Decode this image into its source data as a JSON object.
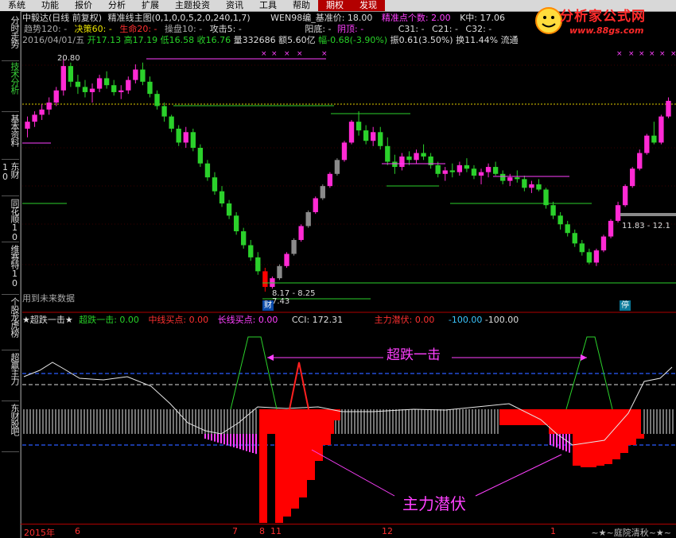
{
  "menubar": [
    "系统",
    "功能",
    "报价",
    "分析",
    "扩展",
    "主题投资",
    "资讯",
    "工具",
    "帮助",
    "期权",
    "发现"
  ],
  "menubar_highlight": [
    9,
    10
  ],
  "sidetabs": [
    "分时走势",
    "技术分析",
    "基本资料",
    "东财10",
    "同花顺10",
    "维赛特10",
    "个股龙虎榜",
    "超赢主力",
    "东财股吧"
  ],
  "info_row1": {
    "title": "中毅达(日线 前复权)",
    "formula": "精准线主图(0,1,0,0,5,2,0,240,1,7)",
    "wen": "WEN98编_基准价: 18.00",
    "precise": "精准点个数: 2.00",
    "k": "K中: 17.06"
  },
  "info_row2": {
    "trend": "趋势120: -",
    "decision": "决策60: -",
    "life": "生命20: -",
    "operate": "操盘10: -",
    "attack": "攻击5: -",
    "yang": "阳底: -",
    "yin": "阴顶: -",
    "c31": "C31: -",
    "c21": "C21: -",
    "c32": "C32: -"
  },
  "info_row3": {
    "date": "2016/04/01/五",
    "open": "开17.13",
    "high": "高17.19",
    "low": "低16.58",
    "close": "收16.76",
    "volume": "量332686",
    "amount": "额5.60亿",
    "change": "幅-0.68(-3.90%)",
    "amplitude": "振0.61(3.50%)",
    "turnover": "换11.44%",
    "flow": "流通"
  },
  "price_labels": {
    "high_mark": "20.80",
    "low_range": "8.17 - 8.25",
    "low_mark": "7.43",
    "right_range": "11.83 - 12.1",
    "future_note": "用到未来数据",
    "cai_badge": "财",
    "ting_badge": "停"
  },
  "indicator_header": {
    "name": "★超跌一击★",
    "s1": "超跌一击: 0.00",
    "s2": "中线买点: 0.00",
    "s3": "长线买点: 0.00",
    "cci": "CCI: 172.31",
    "zlqf": "主力潜伏: 0.00",
    "v1": "-100.00",
    "v2": "-100.00"
  },
  "annotations": {
    "a1": "超跌一击",
    "a2": "主力潜伏"
  },
  "xaxis": {
    "ticks": [
      {
        "label": "2015年"
      },
      {
        "label": "6"
      },
      {
        "label": "7"
      },
      {
        "label": "8"
      },
      {
        "label": "11"
      },
      {
        "label": "12"
      },
      {
        "label": "1"
      }
    ],
    "author": "~★~庭院清秋~★~"
  },
  "logo": {
    "title": "分析家公式网",
    "url": "www.88gs.com"
  },
  "colors": {
    "up": "#ff2ad4",
    "down": "#2bd12b",
    "gray": "#8a8a8a",
    "red": "#ff0000",
    "magenta": "#ff40ff",
    "blue_dash": "#2b5bff"
  },
  "candles": [
    [
      16.8,
      17.5,
      16.3,
      17.2
    ],
    [
      17.2,
      17.8,
      16.9,
      17.6
    ],
    [
      17.6,
      18.2,
      17.3,
      17.9
    ],
    [
      17.9,
      18.6,
      17.6,
      18.3
    ],
    [
      18.3,
      19.2,
      18.1,
      19.0
    ],
    [
      19.0,
      20.8,
      18.7,
      20.4
    ],
    [
      20.4,
      20.6,
      19.2,
      19.5
    ],
    [
      19.5,
      19.9,
      18.8,
      19.2
    ],
    [
      19.2,
      19.6,
      18.6,
      18.9
    ],
    [
      18.9,
      19.4,
      18.3,
      19.1
    ],
    [
      19.1,
      19.9,
      18.9,
      19.7
    ],
    [
      19.7,
      20.1,
      19.1,
      19.3
    ],
    [
      19.3,
      19.6,
      18.7,
      18.9
    ],
    [
      18.9,
      19.3,
      18.5,
      19.0
    ],
    [
      19.0,
      19.8,
      18.8,
      19.6
    ],
    [
      19.6,
      20.5,
      19.4,
      20.2
    ],
    [
      20.2,
      20.6,
      19.3,
      19.5
    ],
    [
      19.5,
      19.8,
      18.6,
      18.8
    ],
    [
      18.8,
      19.0,
      17.9,
      18.1
    ],
    [
      18.1,
      18.3,
      17.2,
      17.5
    ],
    [
      17.5,
      17.6,
      16.6,
      16.8
    ],
    [
      16.8,
      17.0,
      15.8,
      16.0
    ],
    [
      16.0,
      16.9,
      15.7,
      16.6
    ],
    [
      16.6,
      16.8,
      15.5,
      15.7
    ],
    [
      15.7,
      15.9,
      14.6,
      14.8
    ],
    [
      14.8,
      15.0,
      13.8,
      14.0
    ],
    [
      14.0,
      14.3,
      13.0,
      13.2
    ],
    [
      13.2,
      13.5,
      12.3,
      12.5
    ],
    [
      12.5,
      12.7,
      11.6,
      11.8
    ],
    [
      11.8,
      12.0,
      10.7,
      10.9
    ],
    [
      10.9,
      11.1,
      9.9,
      10.1
    ],
    [
      10.1,
      10.4,
      9.2,
      9.4
    ],
    [
      9.4,
      9.7,
      8.4,
      8.6
    ],
    [
      8.6,
      8.8,
      7.43,
      7.7
    ],
    [
      7.7,
      8.3,
      7.6,
      8.2
    ],
    [
      8.2,
      9.0,
      8.1,
      8.9
    ],
    [
      8.9,
      9.7,
      8.8,
      9.6
    ],
    [
      9.6,
      10.5,
      9.5,
      10.4
    ],
    [
      10.4,
      11.3,
      10.3,
      11.2
    ],
    [
      11.2,
      12.1,
      11.1,
      12.0
    ],
    [
      12.0,
      12.9,
      11.9,
      12.8
    ],
    [
      12.8,
      13.6,
      12.7,
      13.5
    ],
    [
      13.5,
      14.3,
      13.4,
      14.2
    ],
    [
      14.2,
      15.1,
      14.1,
      15.0
    ],
    [
      15.0,
      16.1,
      14.9,
      16.0
    ],
    [
      16.0,
      17.3,
      15.9,
      17.2
    ],
    [
      17.2,
      17.8,
      16.4,
      16.7
    ],
    [
      16.7,
      17.0,
      15.9,
      16.1
    ],
    [
      16.1,
      16.9,
      15.8,
      16.6
    ],
    [
      16.6,
      16.9,
      15.6,
      15.8
    ],
    [
      15.8,
      16.3,
      14.7,
      14.9
    ],
    [
      14.9,
      15.3,
      14.2,
      14.6
    ],
    [
      14.6,
      15.4,
      14.4,
      15.2
    ],
    [
      15.2,
      15.5,
      14.7,
      15.0
    ],
    [
      15.0,
      15.6,
      14.8,
      15.4
    ],
    [
      15.4,
      15.9,
      15.0,
      15.2
    ],
    [
      15.2,
      15.4,
      14.5,
      14.7
    ],
    [
      14.7,
      14.9,
      14.0,
      14.2
    ],
    [
      14.2,
      14.6,
      13.8,
      14.4
    ],
    [
      14.4,
      14.8,
      14.0,
      14.3
    ],
    [
      14.3,
      14.9,
      14.1,
      14.7
    ],
    [
      14.7,
      15.1,
      14.3,
      14.5
    ],
    [
      14.5,
      14.7,
      13.9,
      14.1
    ],
    [
      14.1,
      14.5,
      13.6,
      14.3
    ],
    [
      14.3,
      14.8,
      14.0,
      14.6
    ],
    [
      14.6,
      14.9,
      14.1,
      14.2
    ],
    [
      14.2,
      14.4,
      13.6,
      13.8
    ],
    [
      13.8,
      14.2,
      13.5,
      14.0
    ],
    [
      14.0,
      14.4,
      13.7,
      13.9
    ],
    [
      13.9,
      14.1,
      13.2,
      13.4
    ],
    [
      13.4,
      13.8,
      13.1,
      13.6
    ],
    [
      13.6,
      13.9,
      13.2,
      13.3
    ],
    [
      13.3,
      13.4,
      12.2,
      12.4
    ],
    [
      12.4,
      12.6,
      11.6,
      11.8
    ],
    [
      11.8,
      12.0,
      11.0,
      11.3
    ],
    [
      11.3,
      11.5,
      10.6,
      10.8
    ],
    [
      10.8,
      11.0,
      10.0,
      10.2
    ],
    [
      10.2,
      10.4,
      9.5,
      9.7
    ],
    [
      9.7,
      9.9,
      9.0,
      9.1
    ],
    [
      9.1,
      9.9,
      8.9,
      9.8
    ],
    [
      9.8,
      10.7,
      9.7,
      10.6
    ],
    [
      10.6,
      11.6,
      10.5,
      11.5
    ],
    [
      11.5,
      12.6,
      11.4,
      12.4
    ],
    [
      12.4,
      13.6,
      12.3,
      13.5
    ],
    [
      13.5,
      14.6,
      13.4,
      14.5
    ],
    [
      14.5,
      15.6,
      14.4,
      15.4
    ],
    [
      15.4,
      16.5,
      15.3,
      16.4
    ],
    [
      16.4,
      17.2,
      15.9,
      16.0
    ],
    [
      16.0,
      17.6,
      15.9,
      17.5
    ],
    [
      17.5,
      18.6,
      17.4,
      18.4
    ]
  ]
}
